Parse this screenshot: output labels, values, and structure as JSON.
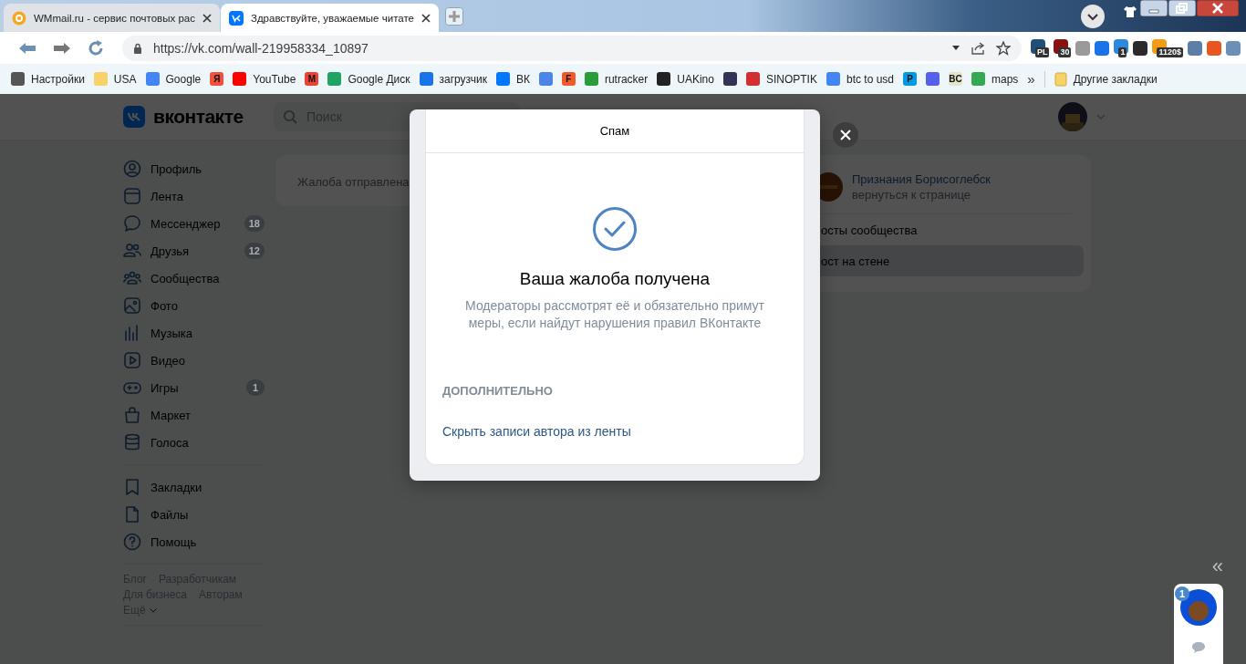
{
  "browser": {
    "tabs": [
      {
        "title": "WMmail.ru - сервис почтовых рас",
        "selected": false
      },
      {
        "title": "Здравствуйте, уважаемые читате",
        "selected": true
      }
    ],
    "address": {
      "url": "https://vk.com/wall-219958334_10897"
    },
    "extensions": [
      {
        "badge": "PL",
        "color": "#1f4e79"
      },
      {
        "badge": "30",
        "color": "#8b1010"
      },
      {
        "color": "#9a9a9a"
      },
      {
        "color": "#1a73e8"
      },
      {
        "badge": "1",
        "color": "#2b8ae0"
      },
      {
        "color": "#2b2b2b"
      },
      {
        "badge": "1120$",
        "color": "#f39c12"
      },
      {
        "color": "#5b7fa6"
      },
      {
        "color": "#e8551f"
      },
      {
        "color": "#6b8fb5"
      }
    ],
    "bookmarks": [
      {
        "label": "Настройки",
        "color": "#555555"
      },
      {
        "label": "USA",
        "color": "#f7d26b"
      },
      {
        "label": "Google",
        "color": "#4285f4"
      },
      {
        "icon_text": "Я",
        "color": "#f0503c"
      },
      {
        "label": "YouTube",
        "color": "#ff0000"
      },
      {
        "icon_text": "M",
        "color": "#ea4335"
      },
      {
        "label": "Google Диск",
        "color": "#1fa463"
      },
      {
        "label": "загрузчик",
        "color": "#1a73e8"
      },
      {
        "label": "ВК",
        "color": "#0077ff"
      },
      {
        "color": "#4a86e8"
      },
      {
        "icon_text": "F",
        "color": "#f05a28"
      },
      {
        "label": "rutracker",
        "color": "#2a9d3a"
      },
      {
        "label": "UAKino",
        "color": "#222222"
      },
      {
        "color": "#333355"
      },
      {
        "label": "SINOPTIK",
        "color": "#d32f2f"
      },
      {
        "label": "btc to usd",
        "color": "#4285f4"
      },
      {
        "icon_text": "P",
        "color": "#0099e5"
      },
      {
        "color": "#5561e8"
      },
      {
        "icon_text": "BC",
        "color": "#e5e5cc"
      },
      {
        "label": "maps",
        "color": "#34a853"
      }
    ],
    "overflow": "»",
    "other_bookmarks": "Другие закладки"
  },
  "vk": {
    "logo": "вконтакте",
    "search": {
      "placeholder": "Поиск"
    },
    "menu": [
      {
        "label": "Профиль"
      },
      {
        "label": "Лента"
      },
      {
        "label": "Мессенджер",
        "count": "18"
      },
      {
        "label": "Друзья",
        "count": "12"
      },
      {
        "label": "Сообщества"
      },
      {
        "label": "Фото"
      },
      {
        "label": "Музыка"
      },
      {
        "label": "Видео"
      },
      {
        "label": "Игры",
        "count": "1"
      },
      {
        "label": "Маркет"
      },
      {
        "label": "Голоса"
      }
    ],
    "menu_extra": [
      {
        "label": "Закладки"
      },
      {
        "label": "Файлы"
      },
      {
        "label": "Помощь"
      }
    ],
    "footer_links": [
      "Блог",
      "Разработчикам",
      "Для бизнеса",
      "Авторам",
      "Ещё"
    ],
    "notice": "Жалоба отправлена",
    "community": {
      "name": "Признания Борисоглебск",
      "link": "вернуться к странице"
    },
    "nav": [
      {
        "label": "осты сообщества",
        "selected": false
      },
      {
        "label": "ост на стене",
        "selected": true
      }
    ]
  },
  "modal": {
    "title": "Спам",
    "heading": "Ваша жалоба получена",
    "text": "Модераторы рассмотрят её и обязательно примут меры, если найдут нарушения правил ВКонтакте",
    "section": "ДОПОЛНИТЕЛЬНО",
    "link": "Скрыть записи автора из ленты"
  },
  "chat": {
    "collapse": "«",
    "badge": "1"
  }
}
